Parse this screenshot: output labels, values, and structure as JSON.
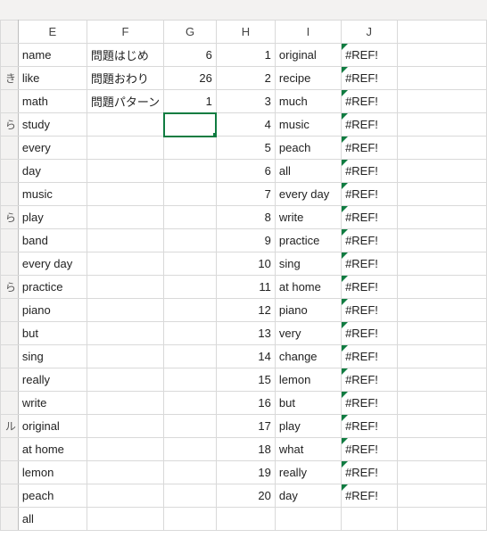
{
  "columns": {
    "E": "E",
    "F": "F",
    "G": "G",
    "H": "H",
    "I": "I",
    "J": "J"
  },
  "stub_fragments": [
    "",
    "き",
    "",
    "ら",
    "",
    "",
    "",
    "ら",
    "",
    "",
    "ら",
    "",
    "",
    "",
    "",
    "",
    "ル",
    "",
    "",
    "",
    ""
  ],
  "E": [
    "name",
    "like",
    "math",
    "study",
    "every",
    "day",
    "music",
    "play",
    "band",
    "every day",
    "practice",
    "piano",
    "but",
    "sing",
    "really",
    "write",
    "original",
    "at home",
    "lemon",
    "peach",
    "all"
  ],
  "F": [
    "問題はじめ",
    "問題おわり",
    "問題パターン",
    "",
    "",
    "",
    "",
    "",
    "",
    "",
    "",
    "",
    "",
    "",
    "",
    "",
    "",
    "",
    "",
    "",
    ""
  ],
  "G": [
    "6",
    "26",
    "1",
    "",
    "",
    "",
    "",
    "",
    "",
    "",
    "",
    "",
    "",
    "",
    "",
    "",
    "",
    "",
    "",
    "",
    ""
  ],
  "H": [
    "1",
    "2",
    "3",
    "4",
    "5",
    "6",
    "7",
    "8",
    "9",
    "10",
    "11",
    "12",
    "13",
    "14",
    "15",
    "16",
    "17",
    "18",
    "19",
    "20",
    ""
  ],
  "I": [
    "original",
    "recipe",
    "much",
    "music",
    "peach",
    "all",
    "every day",
    "write",
    "practice",
    "sing",
    "at home",
    "piano",
    "very",
    "change",
    "lemon",
    "but",
    "play",
    "what",
    "really",
    "day",
    ""
  ],
  "J": [
    "#REF!",
    "#REF!",
    "#REF!",
    "#REF!",
    "#REF!",
    "#REF!",
    "#REF!",
    "#REF!",
    "#REF!",
    "#REF!",
    "#REF!",
    "#REF!",
    "#REF!",
    "#REF!",
    "#REF!",
    "#REF!",
    "#REF!",
    "#REF!",
    "#REF!",
    "#REF!",
    ""
  ],
  "selected_cell": "G4",
  "chart_data": {
    "type": "table",
    "note": "Spreadsheet cell grid, not a chart."
  }
}
